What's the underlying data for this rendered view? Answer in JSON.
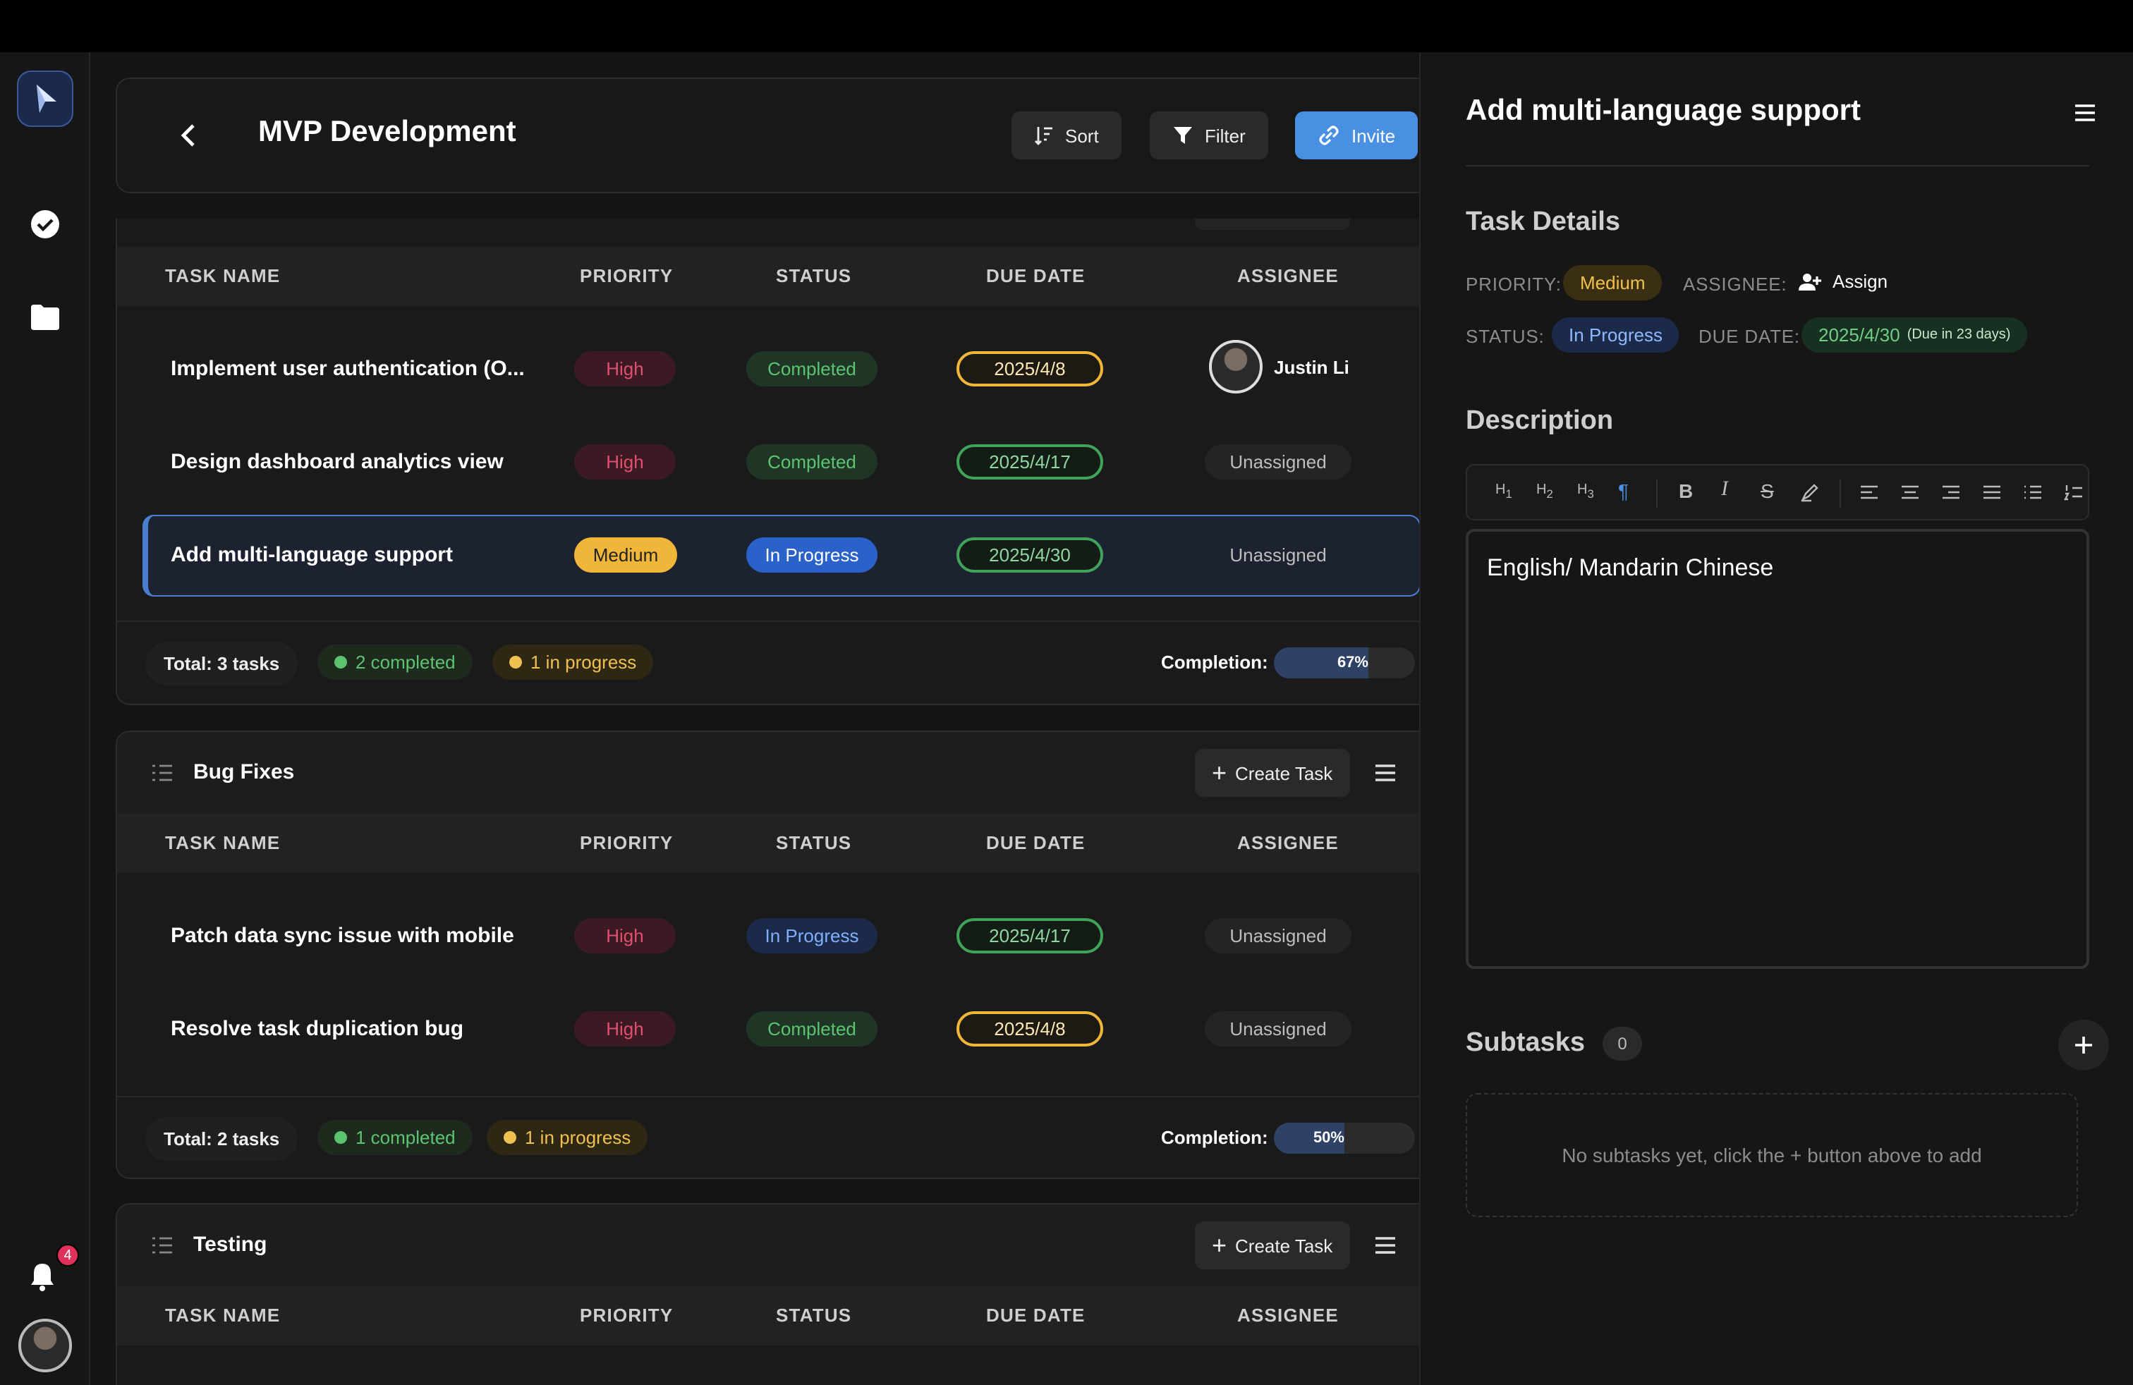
{
  "project": {
    "title": "MVP Development"
  },
  "toolbar": {
    "sort": "Sort",
    "filter": "Filter",
    "invite": "Invite"
  },
  "sidebar": {
    "notification_count": "4"
  },
  "columns": [
    "TASK NAME",
    "PRIORITY",
    "STATUS",
    "DUE DATE",
    "ASSIGNEE"
  ],
  "sections": [
    {
      "title": "",
      "tasks": [
        {
          "name": "Implement user authentication (O...",
          "priority": "High",
          "status": "Completed",
          "due": "2025/4/8",
          "assignee": "Justin Li"
        },
        {
          "name": "Design dashboard analytics view",
          "priority": "High",
          "status": "Completed",
          "due": "2025/4/17",
          "assignee": "Unassigned"
        },
        {
          "name": "Add multi-language support",
          "priority": "Medium",
          "status": "In Progress",
          "due": "2025/4/30",
          "assignee": "Unassigned"
        }
      ],
      "total": "Total: 3 tasks",
      "completed": "2 completed",
      "in_progress": "1 in progress",
      "completion_label": "Completion:",
      "completion": "67%",
      "completion_value": 0.67
    },
    {
      "title": "Bug Fixes",
      "create_label": "Create Task",
      "tasks": [
        {
          "name": "Patch data sync issue with mobile",
          "priority": "High",
          "status": "In Progress",
          "due": "2025/4/17",
          "assignee": "Unassigned"
        },
        {
          "name": "Resolve task duplication bug",
          "priority": "High",
          "status": "Completed",
          "due": "2025/4/8",
          "assignee": "Unassigned"
        }
      ],
      "total": "Total: 2 tasks",
      "completed": "1 completed",
      "in_progress": "1 in progress",
      "completion_label": "Completion:",
      "completion": "50%",
      "completion_value": 0.5
    },
    {
      "title": "Testing",
      "create_label": "Create Task"
    }
  ],
  "detail": {
    "title": "Add multi-language support",
    "task_details": "Task Details",
    "priority_label": "PRIORITY:",
    "priority": "Medium",
    "assignee_label": "ASSIGNEE:",
    "assign": "Assign",
    "status_label": "STATUS:",
    "status": "In Progress",
    "due_label": "DUE DATE:",
    "due": "2025/4/30",
    "due_hint": "(Due in 23 days)",
    "description_heading": "Description",
    "description": "English/ Mandarin Chinese",
    "toolbar": [
      "H1",
      "H2",
      "H3"
    ],
    "subtasks_heading": "Subtasks",
    "subtasks_count": "0",
    "subtasks_empty": "No subtasks yet, click the + button above to add"
  },
  "colors": {
    "accent": "#4a90e2",
    "high": "#e0506e",
    "completed": "#5cc470",
    "medium": "#f0b63a"
  }
}
